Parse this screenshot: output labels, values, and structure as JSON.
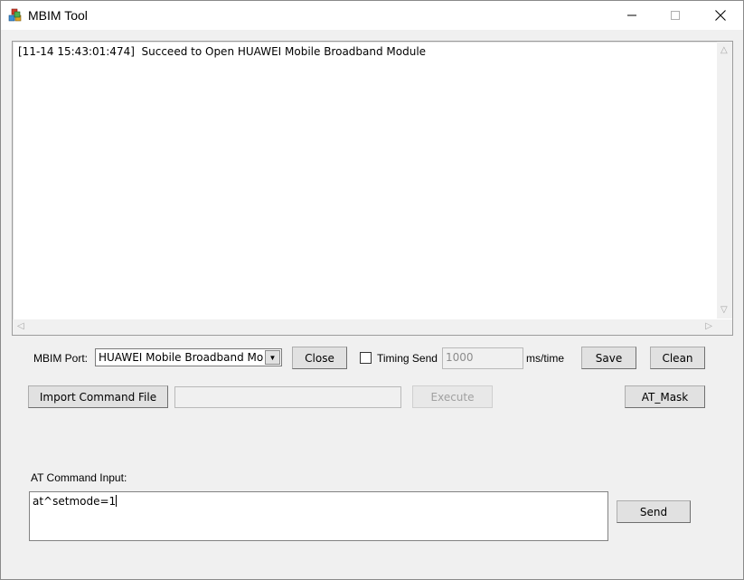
{
  "window": {
    "title": "MBIM Tool"
  },
  "log": {
    "lines": [
      "[11-14 15:43:01:474]  Succeed to Open HUAWEI Mobile Broadband Module"
    ]
  },
  "port": {
    "label": "MBIM Port:",
    "selected": "HUAWEI Mobile Broadband Module",
    "close_label": "Close"
  },
  "timing": {
    "checkbox_label": "Timing Send",
    "checked": false,
    "interval_value": "1000",
    "unit": "ms/time"
  },
  "toolbar": {
    "save_label": "Save",
    "clean_label": "Clean",
    "import_label": "Import Command File",
    "file_path": "",
    "execute_label": "Execute",
    "at_mask_label": "AT_Mask"
  },
  "command": {
    "label": "AT Command Input:",
    "value": "at^setmode=1",
    "send_label": "Send"
  }
}
